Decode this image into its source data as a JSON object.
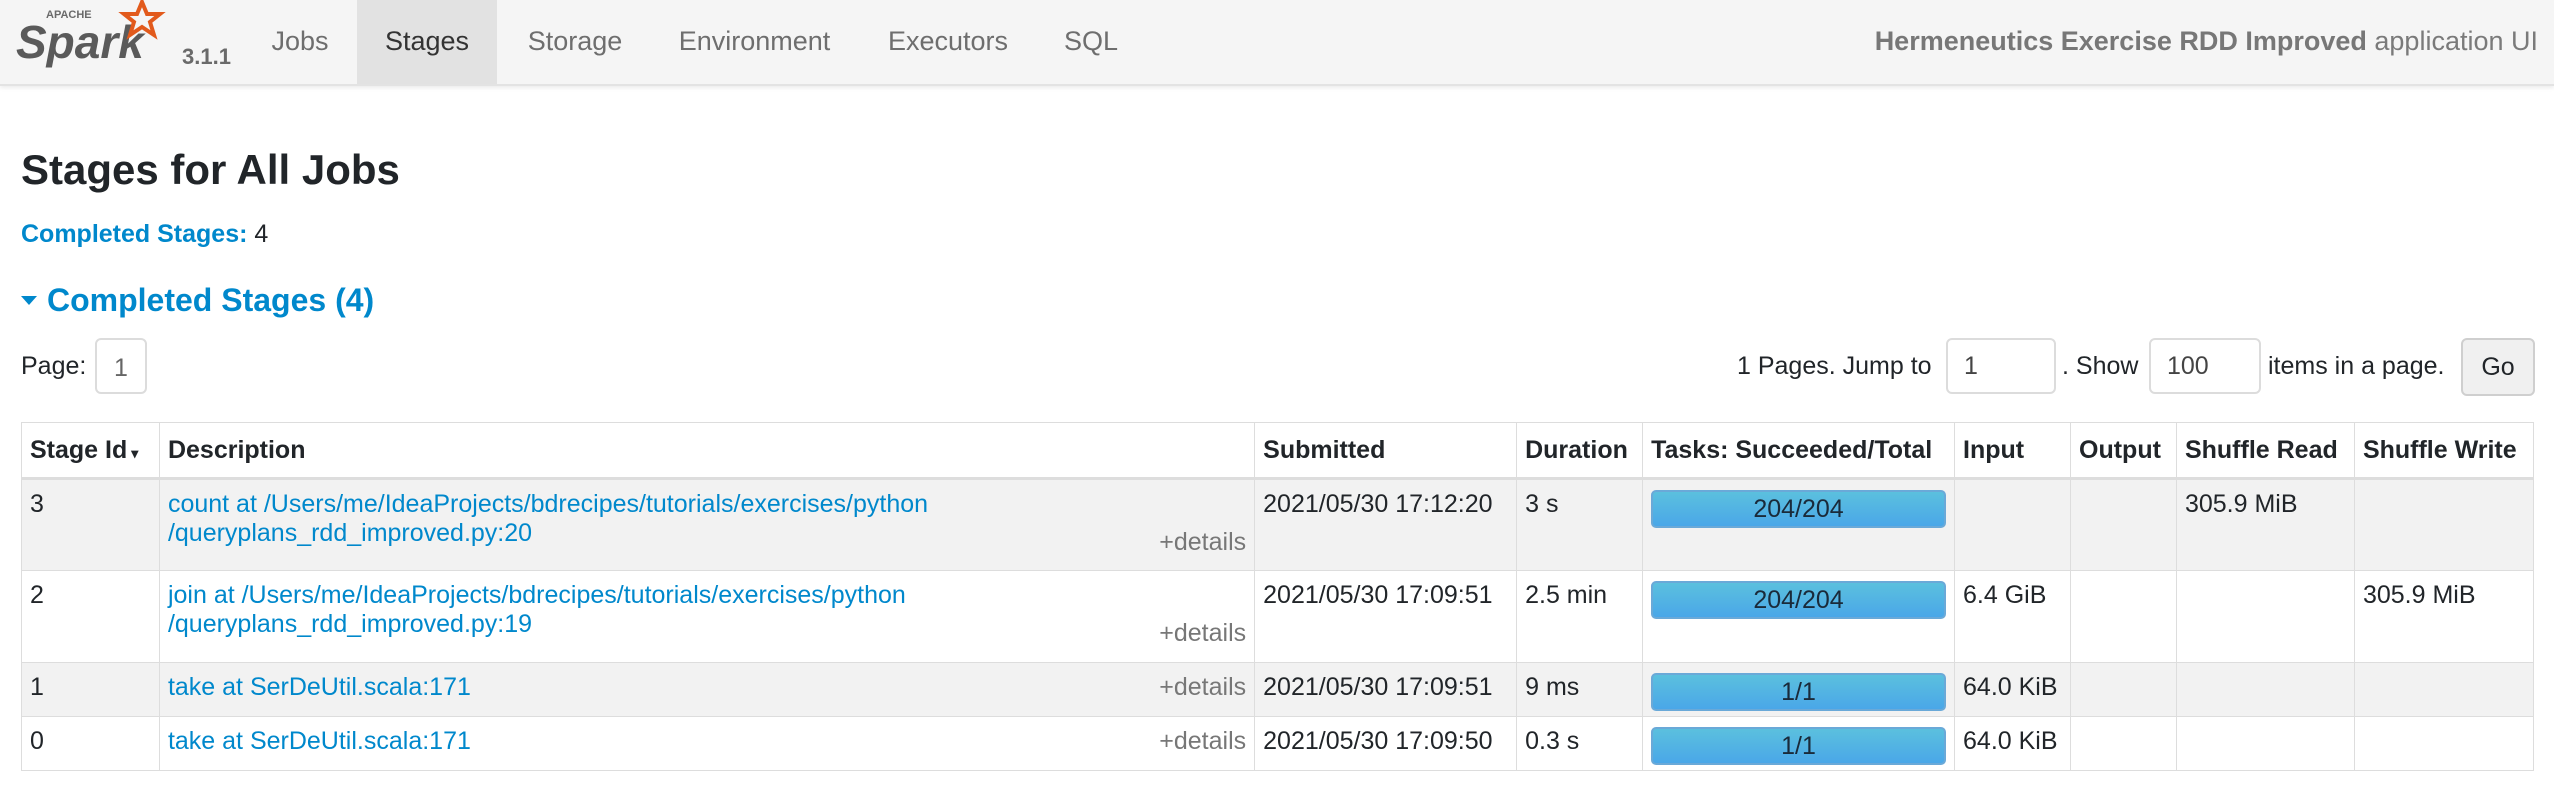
{
  "brand": {
    "logo_text": "Spark",
    "logo_super": "APACHE",
    "version": "3.1.1"
  },
  "nav": {
    "tabs": [
      {
        "label": "Jobs",
        "active": false
      },
      {
        "label": "Stages",
        "active": true
      },
      {
        "label": "Storage",
        "active": false
      },
      {
        "label": "Environment",
        "active": false
      },
      {
        "label": "Executors",
        "active": false
      },
      {
        "label": "SQL",
        "active": false
      }
    ],
    "app_name": "Hermeneutics Exercise RDD Improved",
    "app_suffix": " application UI"
  },
  "page": {
    "title": "Stages for All Jobs",
    "completed_label": "Completed Stages:",
    "completed_count": "4",
    "section_title": "Completed Stages (4)"
  },
  "pager": {
    "page_label": "Page:",
    "page_value": "1",
    "pages_text": "1 Pages. Jump to",
    "jump_value": "1",
    "show_text": ". Show",
    "show_value": "100",
    "items_text": "items in a page.",
    "go_label": "Go"
  },
  "table": {
    "headers": [
      "Stage Id",
      "Description",
      "Submitted",
      "Duration",
      "Tasks: Succeeded/Total",
      "Input",
      "Output",
      "Shuffle Read",
      "Shuffle Write"
    ],
    "sort_indicator": "▾",
    "details_label": "+details",
    "rows": [
      {
        "id": "3",
        "desc_line1": "count at /Users/me/IdeaProjects/bdrecipes/tutorials/exercises/python",
        "desc_line2": "/queryplans_rdd_improved.py:20",
        "submitted": "2021/05/30 17:12:20",
        "duration": "3 s",
        "tasks": "204/204",
        "tasks_fraction": 1.0,
        "input": "",
        "output": "",
        "shuffle_read": "305.9 MiB",
        "shuffle_write": ""
      },
      {
        "id": "2",
        "desc_line1": "join at /Users/me/IdeaProjects/bdrecipes/tutorials/exercises/python",
        "desc_line2": "/queryplans_rdd_improved.py:19",
        "submitted": "2021/05/30 17:09:51",
        "duration": "2.5 min",
        "tasks": "204/204",
        "tasks_fraction": 1.0,
        "input": "6.4 GiB",
        "output": "",
        "shuffle_read": "",
        "shuffle_write": "305.9 MiB"
      },
      {
        "id": "1",
        "desc_line1": "take at SerDeUtil.scala:171",
        "desc_line2": "",
        "submitted": "2021/05/30 17:09:51",
        "duration": "9 ms",
        "tasks": "1/1",
        "tasks_fraction": 1.0,
        "input": "64.0 KiB",
        "output": "",
        "shuffle_read": "",
        "shuffle_write": ""
      },
      {
        "id": "0",
        "desc_line1": "take at SerDeUtil.scala:171",
        "desc_line2": "",
        "submitted": "2021/05/30 17:09:50",
        "duration": "0.3 s",
        "tasks": "1/1",
        "tasks_fraction": 1.0,
        "input": "64.0 KiB",
        "output": "",
        "shuffle_read": "",
        "shuffle_write": ""
      }
    ]
  },
  "colors": {
    "link": "#0088cc",
    "bar": "#5bc0de",
    "logo_star": "#e25a1c",
    "navbar": "#f5f5f5"
  }
}
